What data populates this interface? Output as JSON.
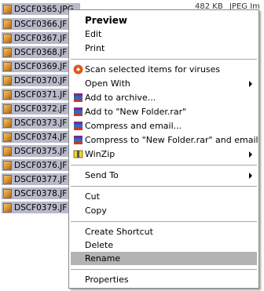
{
  "files": [
    {
      "name": "DSCF0365.JPG"
    },
    {
      "name": "DSCF0366.JF"
    },
    {
      "name": "DSCF0367.JF"
    },
    {
      "name": "DSCF0368.JF"
    },
    {
      "name": "DSCF0369.JF"
    },
    {
      "name": "DSCF0370.JF"
    },
    {
      "name": "DSCF0371.JF"
    },
    {
      "name": "DSCF0372.JF"
    },
    {
      "name": "DSCF0373.JF"
    },
    {
      "name": "DSCF0374.JF"
    },
    {
      "name": "DSCF0375.JF"
    },
    {
      "name": "DSCF0376.JF"
    },
    {
      "name": "DSCF0377.JF"
    },
    {
      "name": "DSCF0378.JF"
    },
    {
      "name": "DSCF0379.JF"
    }
  ],
  "first_row_size": "482 KB",
  "first_row_type": "JPEG Im",
  "menu": {
    "preview": "Preview",
    "edit": "Edit",
    "print": "Print",
    "scan": "Scan selected items for viruses",
    "open_with": "Open With",
    "add_archive": "Add to archive...",
    "add_rar": "Add to \"New Folder.rar\"",
    "compress_email": "Compress and email...",
    "compress_rar_email": "Compress to \"New Folder.rar\" and email",
    "winzip": "WinZip",
    "send_to": "Send To",
    "cut": "Cut",
    "copy": "Copy",
    "create_shortcut": "Create Shortcut",
    "delete": "Delete",
    "rename": "Rename",
    "properties": "Properties"
  },
  "colors": {
    "selection": "#b7b9c9",
    "highlight": "#b3b3b3"
  }
}
